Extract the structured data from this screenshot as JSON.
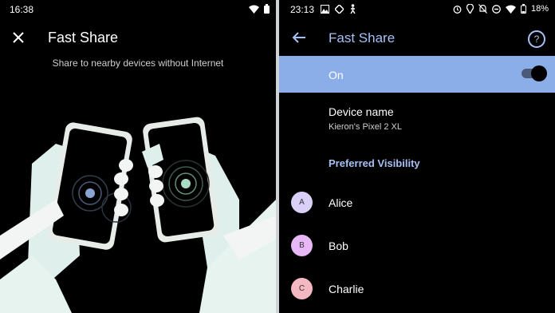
{
  "left": {
    "status": {
      "time": "16:38"
    },
    "title": "Fast Share",
    "subtitle": "Share to nearby devices without Internet",
    "icons": {
      "close": "close-icon",
      "wifi": "wifi-icon",
      "battery": "battery-icon"
    }
  },
  "right": {
    "status": {
      "time": "23:13",
      "battery": "18%"
    },
    "title": "Fast Share",
    "toggle": {
      "label": "On",
      "state": true
    },
    "device": {
      "label": "Device name",
      "value": "Kieron's Pixel 2 XL"
    },
    "section": "Preferred Visibility",
    "contacts": [
      {
        "initial": "A",
        "name": "Alice",
        "color": "#d9cff7"
      },
      {
        "initial": "B",
        "name": "Bob",
        "color": "#e7b8f5"
      },
      {
        "initial": "C",
        "name": "Charlie",
        "color": "#f5b8c2"
      }
    ],
    "colors": {
      "accent": "#a7c1f4",
      "toggle_row": "#8caee8"
    }
  }
}
